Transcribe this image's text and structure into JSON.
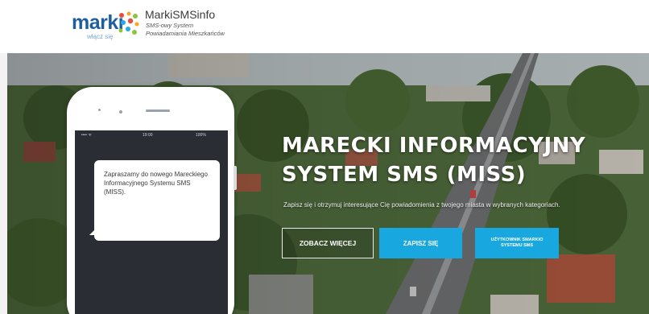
{
  "header": {
    "logo_word": "marki",
    "logo_tagline": "włącz się",
    "brand_title": "MarkiSMSinfo",
    "brand_sub1": "SMS-owy System",
    "brand_sub2": "Powiadamiania Mieszkańców"
  },
  "hero": {
    "title_line1": "MARECKI INFORMACYJNY",
    "title_line2": "SYSTEM SMS (MISS)",
    "subtitle": "Zapisz się i otrzymuj interesujące Cię powiadomienia z twojego miasta w wybranych kategoriach.",
    "buttons": {
      "more": "ZOBACZ WIĘCEJ",
      "signup": "ZAPISZ SIĘ",
      "users": "UŻYTKOWNIK SMARKIO SYSTEMU SMS"
    }
  },
  "phone": {
    "status_carrier": "•••• ᯤ",
    "status_time": "19:00",
    "status_battery": "100%",
    "message": "Zapraszamy do nowego Mareckiego Informacyjnego Systemu SMS (MISS)."
  },
  "colors": {
    "brand_blue": "#1f5e9e",
    "button_blue": "#19a7e0"
  }
}
